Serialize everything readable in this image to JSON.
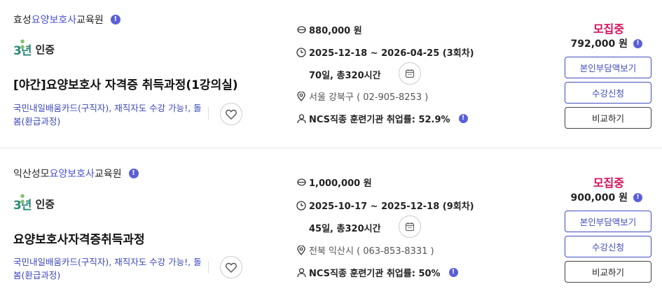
{
  "courses": [
    {
      "institution_prefix": "효성",
      "institution_highlight": "요양보호사",
      "institution_suffix": "교육원",
      "cert_badge": "3년",
      "cert_label": "인증",
      "title": "[야간]요양보호사 자격증 취득과정(1강의실)",
      "tags": "국민내일배움카드(구직자), 재직자도 수강 가능!, 돌봄(환급과정)",
      "fee": "880,000 원",
      "period": "2025-12-18 ~ 2026-04-25 (3회차)",
      "duration": "70일, 총320시간",
      "location": "서울 강북구 ( 02-905-8253 )",
      "employment": "NCS직종 훈련기관 취업률: 52.9%",
      "status": "모집중",
      "self_pay": "792,000 원",
      "btn_self_pay": "본인부담액보기",
      "btn_apply": "수강신청",
      "btn_compare": "비교하기"
    },
    {
      "institution_prefix": "익산성모",
      "institution_highlight": "요양보호사",
      "institution_suffix": "교육원",
      "cert_badge": "3년",
      "cert_label": "인증",
      "title": "요양보호사자격증취득과정",
      "tags": "국민내일배움카드(구직자), 재직자도 수강 가능!, 돌봄(환급과정)",
      "fee": "1,000,000 원",
      "period": "2025-10-17 ~ 2025-12-18 (9회차)",
      "duration": "45일, 총320시간",
      "location": "전북 익산시 ( 063-853-8331 )",
      "employment": "NCS직종 훈련기관 취업률: 50%",
      "status": "모집중",
      "self_pay": "900,000 원",
      "btn_self_pay": "본인부담액보기",
      "btn_apply": "수강신청",
      "btn_compare": "비교하기"
    }
  ],
  "colors": {
    "accent": "#4a4fd6",
    "status": "#d6105a",
    "tag": "#3c47b8"
  },
  "icons": [
    "info-icon",
    "heart-icon",
    "coin-icon",
    "clock-icon",
    "calendar-icon",
    "location-pin-icon",
    "person-icon"
  ]
}
